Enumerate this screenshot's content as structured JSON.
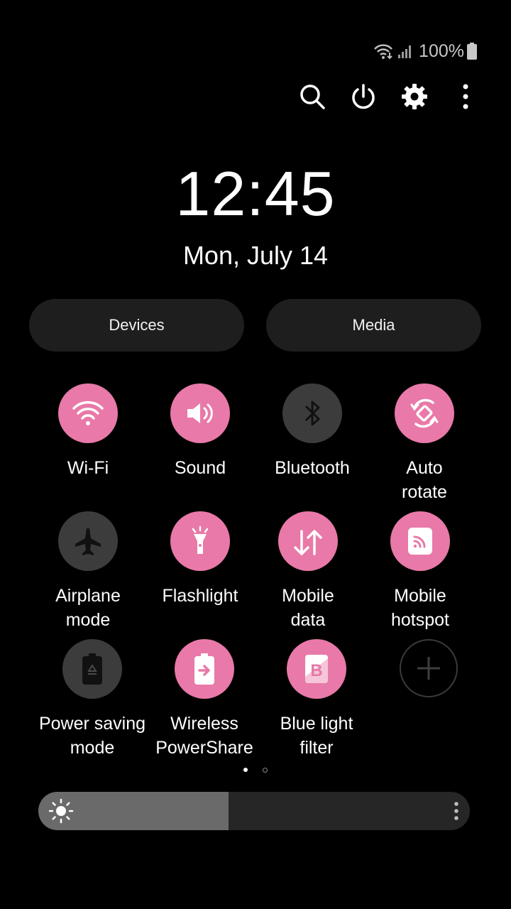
{
  "status_bar": {
    "wifi_icon": "wifi-data-icon",
    "signal_icon": "signal-icon",
    "battery_text": "100%",
    "battery_icon": "battery-icon"
  },
  "actions": [
    "search-icon",
    "power-icon",
    "gear-icon",
    "more-vert-icon"
  ],
  "clock": {
    "time": "12:45",
    "date": "Mon, July 14"
  },
  "buttons": {
    "devices": "Devices",
    "media": "Media"
  },
  "accent_color": "#e879a8",
  "tiles": [
    {
      "label": "Wi-Fi",
      "state": "on",
      "icon": "wifi-icon"
    },
    {
      "label": "Sound",
      "state": "on",
      "icon": "speaker-icon"
    },
    {
      "label": "Bluetooth",
      "state": "off",
      "icon": "bluetooth-icon"
    },
    {
      "label": "Auto\nrotate",
      "state": "on",
      "icon": "rotate-icon"
    },
    {
      "label": "Airplane\nmode",
      "state": "off",
      "icon": "airplane-icon"
    },
    {
      "label": "Flashlight",
      "state": "on",
      "icon": "flashlight-icon"
    },
    {
      "label": "Mobile\ndata",
      "state": "on",
      "icon": "data-arrows-icon"
    },
    {
      "label": "Mobile\nhotspot",
      "state": "on",
      "icon": "hotspot-icon"
    },
    {
      "label": "Power saving\nmode",
      "state": "off",
      "icon": "battery-saver-icon"
    },
    {
      "label": "Wireless\nPowerShare",
      "state": "on",
      "icon": "powershare-icon"
    },
    {
      "label": "Blue light\nfilter",
      "state": "on",
      "icon": "blue-light-icon"
    },
    {
      "label": "",
      "state": "add",
      "icon": "add-icon"
    }
  ],
  "pagination": {
    "pages": 2,
    "current": 1
  },
  "brightness": {
    "level": 0.44,
    "icon": "sun-icon",
    "menu_icon": "more-vert-icon"
  }
}
